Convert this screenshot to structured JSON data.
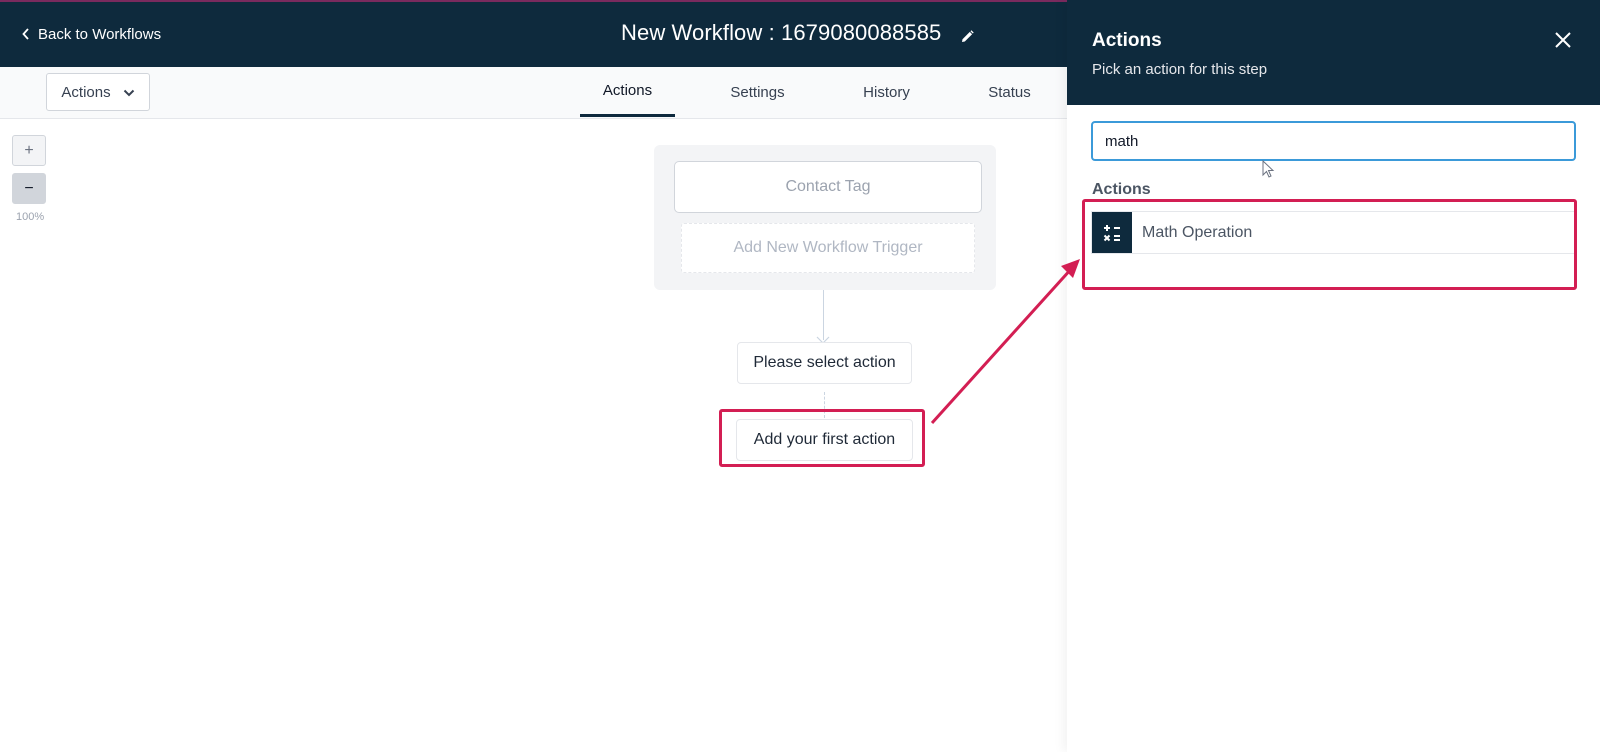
{
  "header": {
    "back_label": "Back to Workflows",
    "title": "New Workflow : 1679080088585"
  },
  "subbar": {
    "actions_dropdown_label": "Actions",
    "tabs": [
      {
        "label": "Actions",
        "active": true
      },
      {
        "label": "Settings",
        "active": false
      },
      {
        "label": "History",
        "active": false
      },
      {
        "label": "Status",
        "active": false
      }
    ]
  },
  "zoom": {
    "plus": "+",
    "minus": "−",
    "level": "100%"
  },
  "canvas": {
    "trigger_label": "Contact Tag",
    "add_trigger_label": "Add New Workflow Trigger",
    "select_action_label": "Please select action",
    "first_action_label": "Add your first action"
  },
  "panel": {
    "title": "Actions",
    "subtitle": "Pick an action for this step",
    "search_value": "math",
    "section_label": "Actions",
    "results": [
      {
        "label": "Math Operation",
        "icon": "calculator-icon"
      }
    ]
  },
  "colors": {
    "header_bg": "#0e2a3d",
    "highlight": "#d31e53",
    "search_border": "#3b9ad9"
  }
}
